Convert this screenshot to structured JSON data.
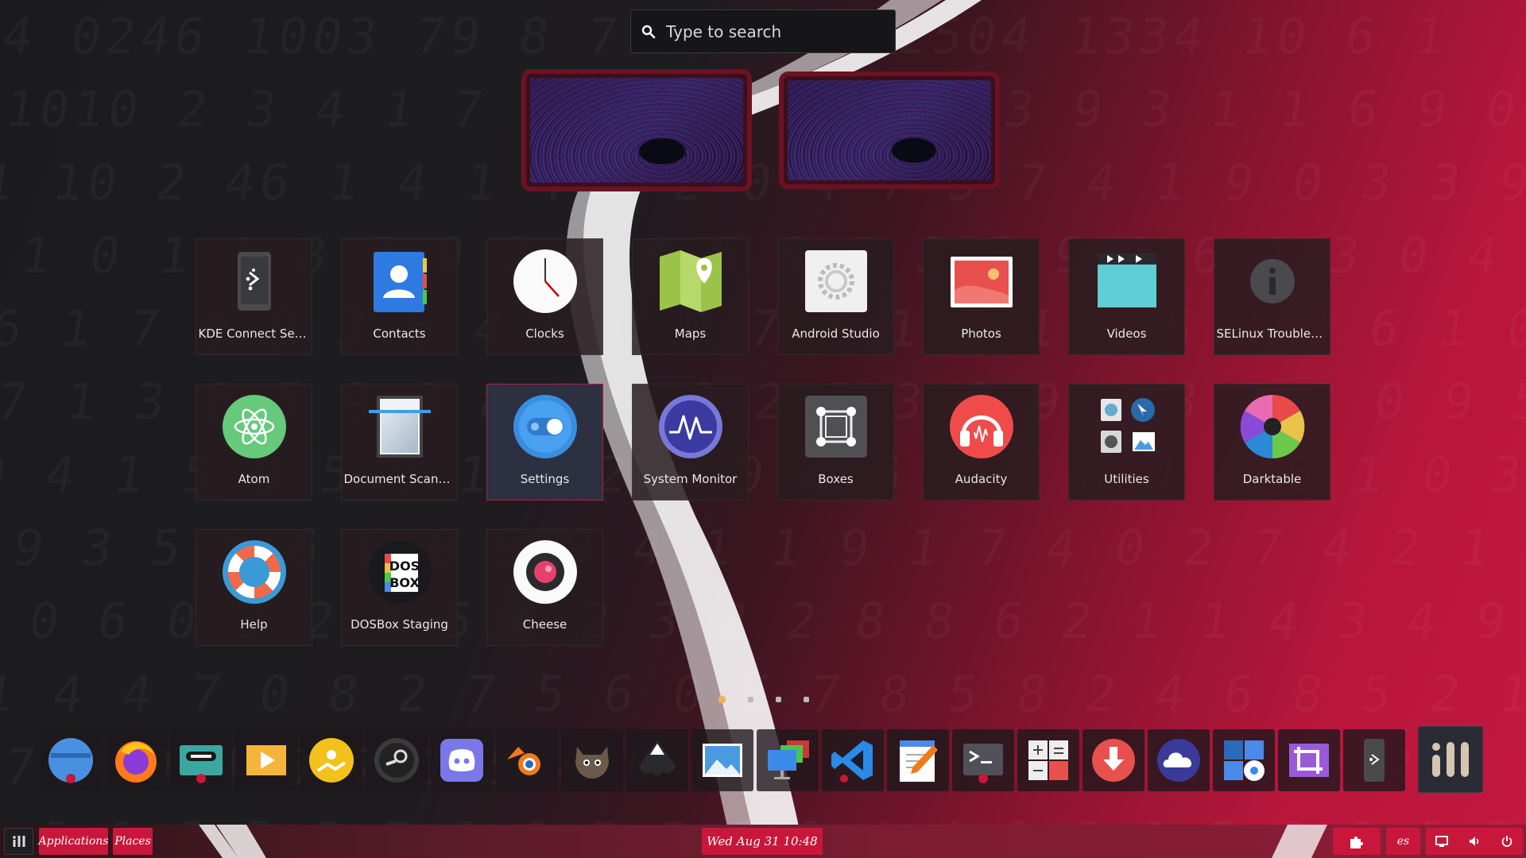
{
  "search": {
    "placeholder": "Type to search",
    "icon": "search-icon"
  },
  "workspaces": [
    {
      "name": "workspace-1"
    },
    {
      "name": "workspace-2"
    }
  ],
  "grid": {
    "rows": [
      [
        {
          "label": "KDE Connect Sett...",
          "icon": "kde-connect-icon"
        },
        {
          "label": "Contacts",
          "icon": "contacts-icon"
        },
        {
          "label": "Clocks",
          "icon": "clock-icon"
        },
        {
          "label": "Maps",
          "icon": "maps-icon"
        },
        {
          "label": "Android Studio",
          "icon": "android-studio-icon"
        },
        {
          "label": "Photos",
          "icon": "photos-icon"
        },
        {
          "label": "Videos",
          "icon": "videos-icon"
        },
        {
          "label": "SELinux Troubles...",
          "icon": "info-icon"
        }
      ],
      [
        {
          "label": "Atom",
          "icon": "atom-icon"
        },
        {
          "label": "Document Scanner",
          "icon": "scanner-icon"
        },
        {
          "label": "Settings",
          "icon": "settings-toggle-icon",
          "active": true
        },
        {
          "label": "System Monitor",
          "icon": "system-monitor-icon"
        },
        {
          "label": "Boxes",
          "icon": "boxes-icon"
        },
        {
          "label": "Audacity",
          "icon": "audacity-icon"
        },
        {
          "label": "Utilities",
          "icon": "utilities-folder-icon"
        },
        {
          "label": "Darktable",
          "icon": "darktable-icon"
        }
      ],
      [
        {
          "label": "Help",
          "icon": "help-lifebuoy-icon"
        },
        {
          "label": "DOSBox Staging",
          "icon": "dosbox-icon"
        },
        {
          "label": "Cheese",
          "icon": "cheese-icon"
        }
      ]
    ]
  },
  "dosbox_logo_text": [
    "DOS",
    "BOX"
  ],
  "pager": {
    "pages": 4,
    "current": 1
  },
  "dock": [
    "files-icon",
    "firefox-icon",
    "tape-recorder-icon",
    "video-player-icon",
    "software-installer-icon",
    "steam-icon",
    "discord-icon",
    "blender-icon",
    "gimp-icon",
    "inkscape-icon",
    "image-viewer-icon",
    "remote-desktop-icon",
    "vscode-icon",
    "text-editor-icon",
    "terminal-icon",
    "calculator-icon",
    "downloader-icon",
    "weather-icon",
    "disk-utility-icon",
    "crop-tool-icon",
    "kde-connect-icon"
  ],
  "taskbar": {
    "applications_label": "Applications",
    "places_label": "Places",
    "clock": "Wed Aug 31  10:48",
    "keyboard_layout": "es"
  },
  "colors": {
    "accent": "#c8173b",
    "active_border": "#b02040"
  }
}
